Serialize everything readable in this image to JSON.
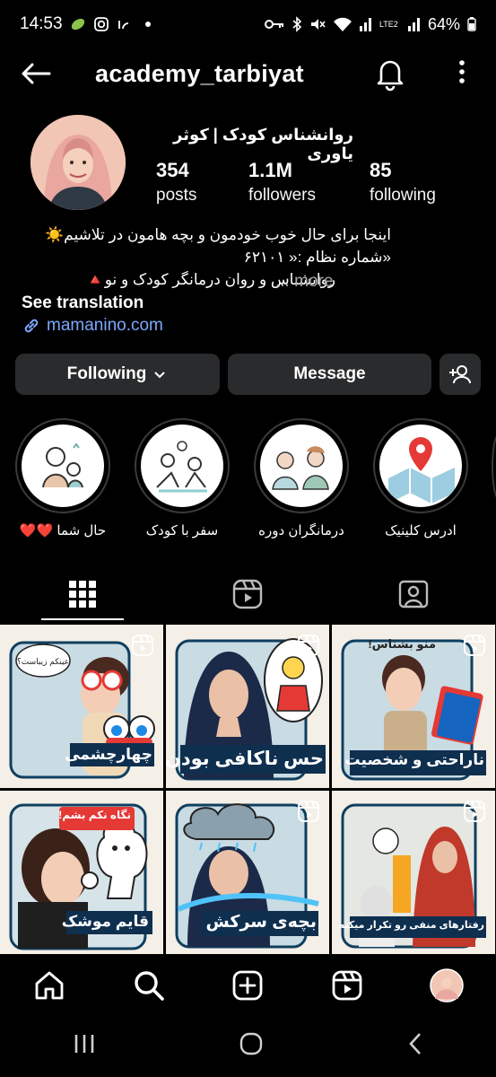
{
  "status_bar": {
    "time": "14:53",
    "battery": "64%",
    "network": "LTE2"
  },
  "header": {
    "username": "academy_tarbiyat"
  },
  "profile": {
    "display_name": "روانشناس کودک | کوثر یاوری",
    "stats": [
      {
        "value": "354",
        "label": "posts"
      },
      {
        "value": "1.1M",
        "label": "followers"
      },
      {
        "value": "85",
        "label": "following"
      }
    ]
  },
  "bio": {
    "line1": "اینجا برای حال خوب خودمون و بچه هامون در تلاشیم☀️",
    "line2": "«شماره نظام :« ۶۲۱۰۱",
    "line3": "روانشناس و روان درمانگر کودک و نو🔺",
    "more": "... more",
    "see_translation": "See translation",
    "link": "mamanino.com"
  },
  "buttons": {
    "following": "Following",
    "message": "Message"
  },
  "highlights": [
    {
      "label": "حال شما ❤️❤️"
    },
    {
      "label": "سفر با کودک"
    },
    {
      "label": "درمانگران دوره"
    },
    {
      "label": "ادرس کلینیک"
    }
  ],
  "posts": [
    {
      "caption": "چهارچشمی",
      "speech": "عینکم زیبات؟ چهارچشم"
    },
    {
      "caption": "حس ناکافی بودن",
      "speech": ""
    },
    {
      "caption": "ناراحتی و شخصیت",
      "speech": "منو بشناس!"
    },
    {
      "caption": "قایم موشک",
      "speech": "نگاه نکم بشم!"
    },
    {
      "caption": "بچه‌ی سرکش",
      "speech": ""
    },
    {
      "caption": "رفتارهای منفی رو تکرار میکنه",
      "speech": ""
    }
  ],
  "colors": {
    "accent_link": "#7ea8ff",
    "button_bg": "#2a2b2d",
    "post_caption_bg": "#0f2f4f"
  }
}
